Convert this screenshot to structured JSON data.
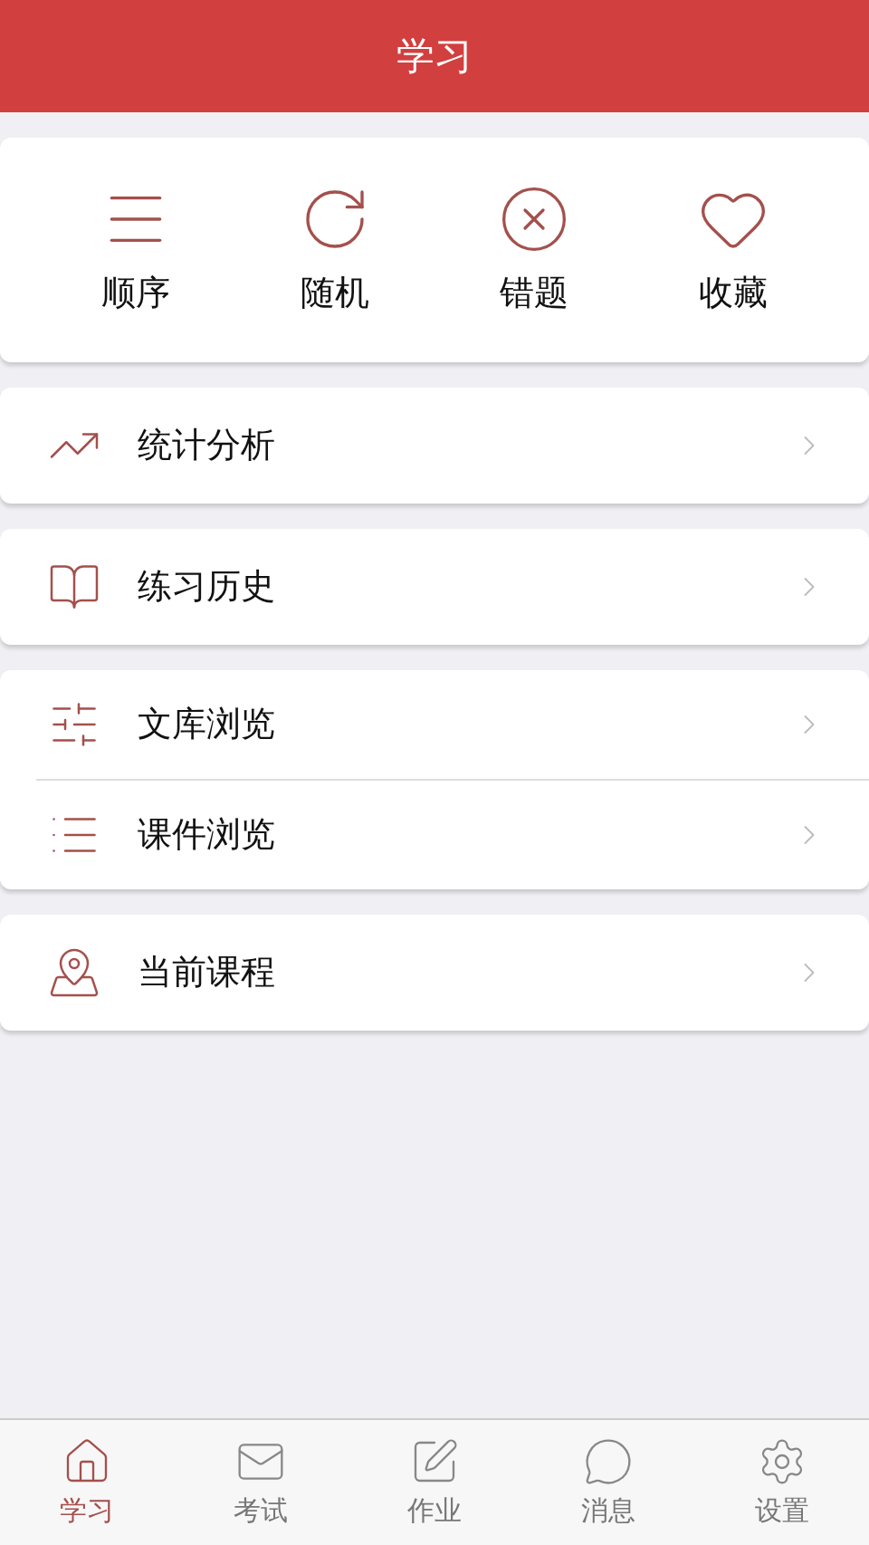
{
  "header": {
    "title": "学习"
  },
  "quick_actions": [
    {
      "kind": "order",
      "label": "顺序"
    },
    {
      "kind": "random",
      "label": "随机"
    },
    {
      "kind": "wrong",
      "label": "错题"
    },
    {
      "kind": "favorite",
      "label": "收藏"
    }
  ],
  "menu_groups": [
    [
      {
        "kind": "stats",
        "label": "统计分析"
      }
    ],
    [
      {
        "kind": "history",
        "label": "练习历史"
      }
    ],
    [
      {
        "kind": "library",
        "label": "文库浏览"
      },
      {
        "kind": "courseware",
        "label": "课件浏览"
      }
    ],
    [
      {
        "kind": "course",
        "label": "当前课程"
      }
    ]
  ],
  "tab_bar": [
    {
      "kind": "study",
      "label": "学习",
      "selected": true
    },
    {
      "kind": "exam",
      "label": "考试",
      "selected": false
    },
    {
      "kind": "homework",
      "label": "作业",
      "selected": false
    },
    {
      "kind": "message",
      "label": "消息",
      "selected": false
    },
    {
      "kind": "settings",
      "label": "设置",
      "selected": false
    }
  ]
}
